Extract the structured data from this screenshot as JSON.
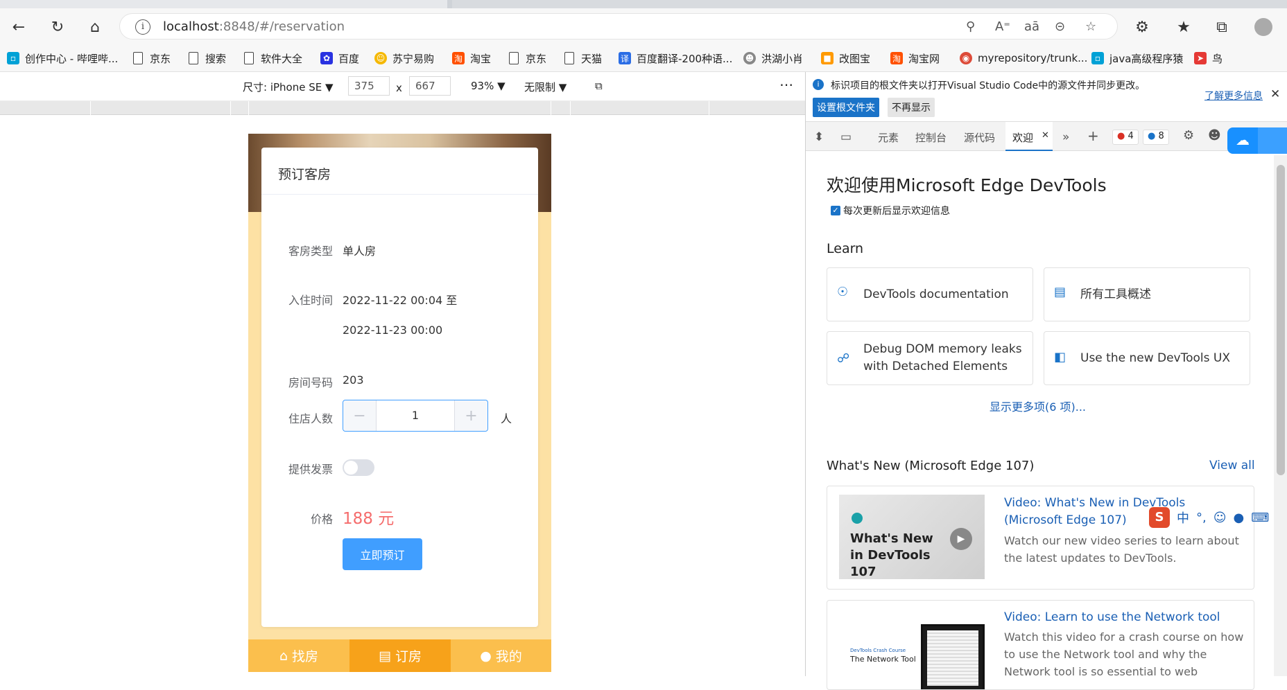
{
  "browser": {
    "url_host": "localhost",
    "url_rest": ":8848/#/reservation",
    "bookmarks": [
      {
        "label": "创作中心 - 哔哩哔...",
        "icon": "bilibili-icon",
        "color": "#00a1d6"
      },
      {
        "label": "京东",
        "icon": "page-icon"
      },
      {
        "label": "搜索",
        "icon": "page-icon"
      },
      {
        "label": "软件大全",
        "icon": "page-icon"
      },
      {
        "label": "百度",
        "icon": "baidu-icon",
        "color": "#2932e1"
      },
      {
        "label": "苏宁易购",
        "icon": "suning-icon",
        "color": "#f5b800"
      },
      {
        "label": "淘宝",
        "icon": "taobao-icon",
        "color": "#ff5000"
      },
      {
        "label": "京东",
        "icon": "page-icon"
      },
      {
        "label": "天猫",
        "icon": "page-icon"
      },
      {
        "label": "百度翻译-200种语...",
        "icon": "translate-icon",
        "color": "#2b6de5"
      },
      {
        "label": "洪湖小肖",
        "icon": "avatar-icon",
        "color": "#888888"
      },
      {
        "label": "改图宝",
        "icon": "gaitubao-icon",
        "color": "#ff9a00"
      },
      {
        "label": "淘宝网",
        "icon": "taobao-icon",
        "color": "#ff5000"
      },
      {
        "label": "myrepository/trunk...",
        "icon": "chrome-icon",
        "color": "#dd4b39"
      },
      {
        "label": "java高级程序猿",
        "icon": "bilibili-icon",
        "color": "#00a1d6"
      },
      {
        "label": "鸟",
        "icon": "bird-icon",
        "color": "#e53935"
      }
    ]
  },
  "device_toolbar": {
    "size_label": "尺寸: iPhone SE",
    "width": "375",
    "times": "x",
    "height": "667",
    "zoom": "93%",
    "throttle": "无限制"
  },
  "reservation": {
    "title": "预订客房",
    "room_type_label": "客房类型",
    "room_type_value": "单人房",
    "checkin_label": "入住时间",
    "checkin_value": "2022-11-22 00:04 至",
    "checkout_value": "2022-11-23 00:00",
    "room_no_label": "房间号码",
    "room_no_value": "203",
    "guests_label": "住店人数",
    "guests_value": "1",
    "guests_unit": "人",
    "minus": "−",
    "plus": "+",
    "invoice_label": "提供发票",
    "invoice_on": false,
    "price_label": "价格",
    "price_value": "188 元",
    "book_button": "立即预订",
    "accent_color": "#409eff",
    "price_color": "#f56c6c"
  },
  "tabbar": {
    "items": [
      {
        "label": "找房",
        "icon": "home-icon"
      },
      {
        "label": "订房",
        "icon": "clipboard-icon",
        "active": true
      },
      {
        "label": "我的",
        "icon": "user-icon"
      }
    ]
  },
  "devtools": {
    "info_text": "标识项目的根文件夹以打开Visual Studio Code中的源文件并同步更改。",
    "learn_more": "了解更多信息",
    "set_root_btn": "设置根文件夹",
    "dont_show_btn": "不再显示",
    "tabs": [
      "元素",
      "控制台",
      "源代码",
      "欢迎"
    ],
    "active_tab": "欢迎",
    "errors": "4",
    "messages": "8",
    "welcome_title": "欢迎使用Microsoft Edge DevTools",
    "show_welcome_checkbox": "每次更新后显示欢迎信息",
    "learn_heading": "Learn",
    "learn_cards": [
      {
        "text": "DevTools documentation"
      },
      {
        "text": "所有工具概述"
      },
      {
        "text": "Debug DOM memory leaks with Detached Elements"
      },
      {
        "text": "Use the new DevTools UX"
      }
    ],
    "show_more": "显示更多项(6 项)...",
    "whats_new_heading": "What's New (Microsoft Edge 107)",
    "view_all": "View all",
    "news": [
      {
        "thumb_text": "What's New in DevTools 107",
        "title": "Video: What's New in DevTools (Microsoft Edge 107)",
        "desc": "Watch our new video series to learn about the latest updates to DevTools."
      },
      {
        "thumb_small": "DevTools Crash Course",
        "thumb_text": "The Network Tool",
        "title": "Video: Learn to use the Network tool",
        "desc": "Watch this video for a crash course on how to use the Network tool and why the Network tool is so essential to web"
      }
    ],
    "ime": [
      "中",
      "°,"
    ]
  }
}
